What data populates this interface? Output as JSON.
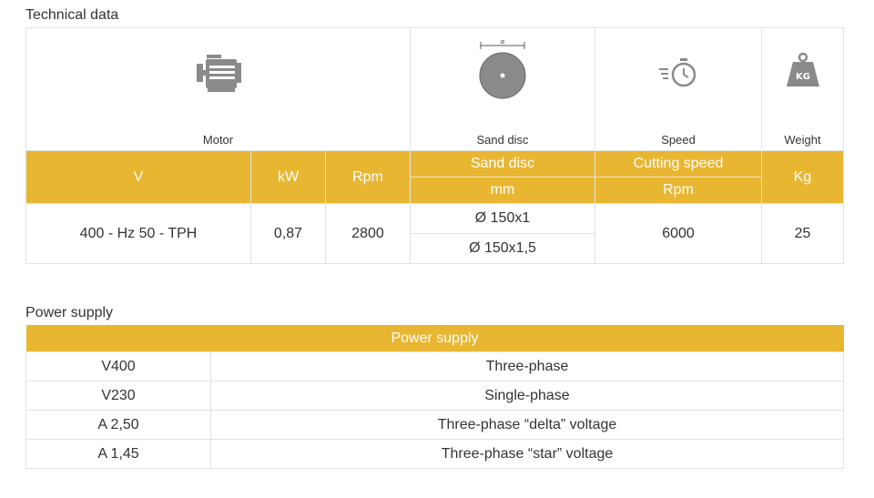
{
  "technical": {
    "title": "Technical data",
    "icons": {
      "motor_label": "Motor",
      "disc_label": "Sand disc",
      "disc_glyph": "ø",
      "speed_label": "Speed",
      "weight_label": "Weight",
      "weight_glyph": "KG"
    },
    "headers": {
      "v": "V",
      "kw": "kW",
      "rpm": "Rpm",
      "sand_disc": "Sand disc",
      "sand_disc_unit": "mm",
      "cutting_speed": "Cutting speed",
      "cutting_speed_unit": "Rpm",
      "kg": "Kg"
    },
    "row": {
      "v": "400 - Hz 50 - TPH",
      "kw": "0,87",
      "rpm": "2800",
      "disc_1": "Ø 150x1",
      "disc_2": "Ø 150x1,5",
      "cutting_speed": "6000",
      "kg": "25"
    }
  },
  "power": {
    "title": "Power supply",
    "header": "Power supply",
    "rows": [
      {
        "key": "V400",
        "value": "Three-phase"
      },
      {
        "key": "V230",
        "value": "Single-phase"
      },
      {
        "key": "A 2,50",
        "value": "Three-phase “delta” voltage"
      },
      {
        "key": "A 1,45",
        "value": "Three-phase “star” voltage"
      }
    ]
  },
  "colors": {
    "accent": "#e8b631",
    "icon_gray": "#8a8a8a",
    "border": "#e2e2e2"
  }
}
